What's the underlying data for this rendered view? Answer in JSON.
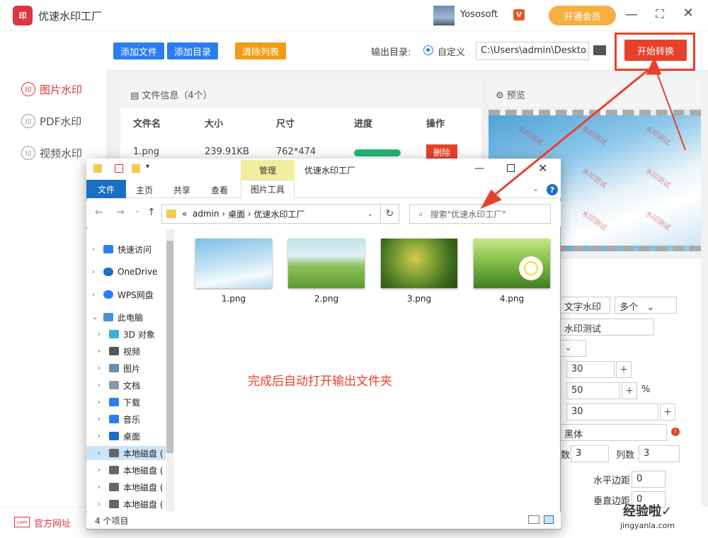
{
  "app": {
    "title": "优速水印工厂",
    "logo_text": "印",
    "username": "Yososoft",
    "vip_badge": "V",
    "vip_button": "开通会员",
    "min": "—",
    "max": "⛶",
    "close": "✕"
  },
  "sidebar": {
    "items": [
      {
        "label": "图片水印",
        "icon": "印",
        "active": true
      },
      {
        "label": "PDF水印",
        "icon": "印",
        "active": false
      },
      {
        "label": "视频水印",
        "icon": "印",
        "active": false
      }
    ],
    "footer_icon": "com",
    "footer_link": "官方网址"
  },
  "toolbar": {
    "add_file": "添加文件",
    "add_dir": "添加目录",
    "clear_list": "清除列表",
    "output_label": "输出目录:",
    "output_option": "自定义",
    "output_path": "C:\\Users\\admin\\Deskto",
    "start": "开始转换"
  },
  "file_panel": {
    "title": "文件信息（4个）",
    "columns": [
      "文件名",
      "大小",
      "尺寸",
      "进度",
      "操作"
    ],
    "rows": [
      {
        "name": "1.png",
        "size": "239.91KB",
        "dims": "762*474",
        "progress": 1.0,
        "action": "删除"
      }
    ]
  },
  "preview": {
    "title": "预览",
    "watermark": "水印测试"
  },
  "settings": {
    "type": "文字水印",
    "mode": "多个",
    "text": "水印测试",
    "v1": "30",
    "v2": "50",
    "unit": "%",
    "v3": "30",
    "font": "黑体",
    "rows_label": "行数",
    "rows": "3",
    "cols_label": "列数",
    "cols": "3",
    "hmargin_label": "水平边距",
    "hmargin": "0",
    "vmargin_label": "垂直边距",
    "vmargin": "0",
    "plus": "+"
  },
  "explorer": {
    "manage_tab": "管理",
    "window_title": "优速水印工厂",
    "pict_tools": "图片工具",
    "ribbon_tabs": [
      "文件",
      "主页",
      "共享",
      "查看"
    ],
    "address": [
      "«",
      "admin",
      "›",
      "桌面",
      "›",
      "优速水印工厂"
    ],
    "search_placeholder": "搜索\"优速水印工厂\"",
    "nav": [
      {
        "label": "快速访问",
        "color": "#2a7ef0"
      },
      {
        "label": "OneDrive",
        "color": "#1a6fc4"
      },
      {
        "label": "WPS网盘",
        "color": "#2a7ef0"
      },
      {
        "label": "此电脑",
        "color": "#4a90d9"
      },
      {
        "label": "3D 对象",
        "color": "#3ab0d8"
      },
      {
        "label": "视频",
        "color": "#555555"
      },
      {
        "label": "图片",
        "color": "#6a8fb0"
      },
      {
        "label": "文档",
        "color": "#8899aa"
      },
      {
        "label": "下载",
        "color": "#2a7ef0"
      },
      {
        "label": "音乐",
        "color": "#2a7ef0"
      },
      {
        "label": "桌面",
        "color": "#1a6fc4"
      },
      {
        "label": "本地磁盘 (",
        "color": "#666666"
      },
      {
        "label": "本地磁盘 (",
        "color": "#666666"
      },
      {
        "label": "本地磁盘 (",
        "color": "#666666"
      },
      {
        "label": "本地磁盘 (",
        "color": "#666666"
      }
    ],
    "files": [
      "1.png",
      "2.png",
      "3.png",
      "4.png"
    ],
    "note": "完成后自动打开输出文件夹",
    "status": "4 个项目"
  },
  "overlay": {
    "logo": "经验啦✓",
    "url": "jingyanla.com"
  },
  "colors": {
    "accent": "#e8412b",
    "blue_btn": "#2a7ef0",
    "orange_btn": "#f39c12"
  }
}
